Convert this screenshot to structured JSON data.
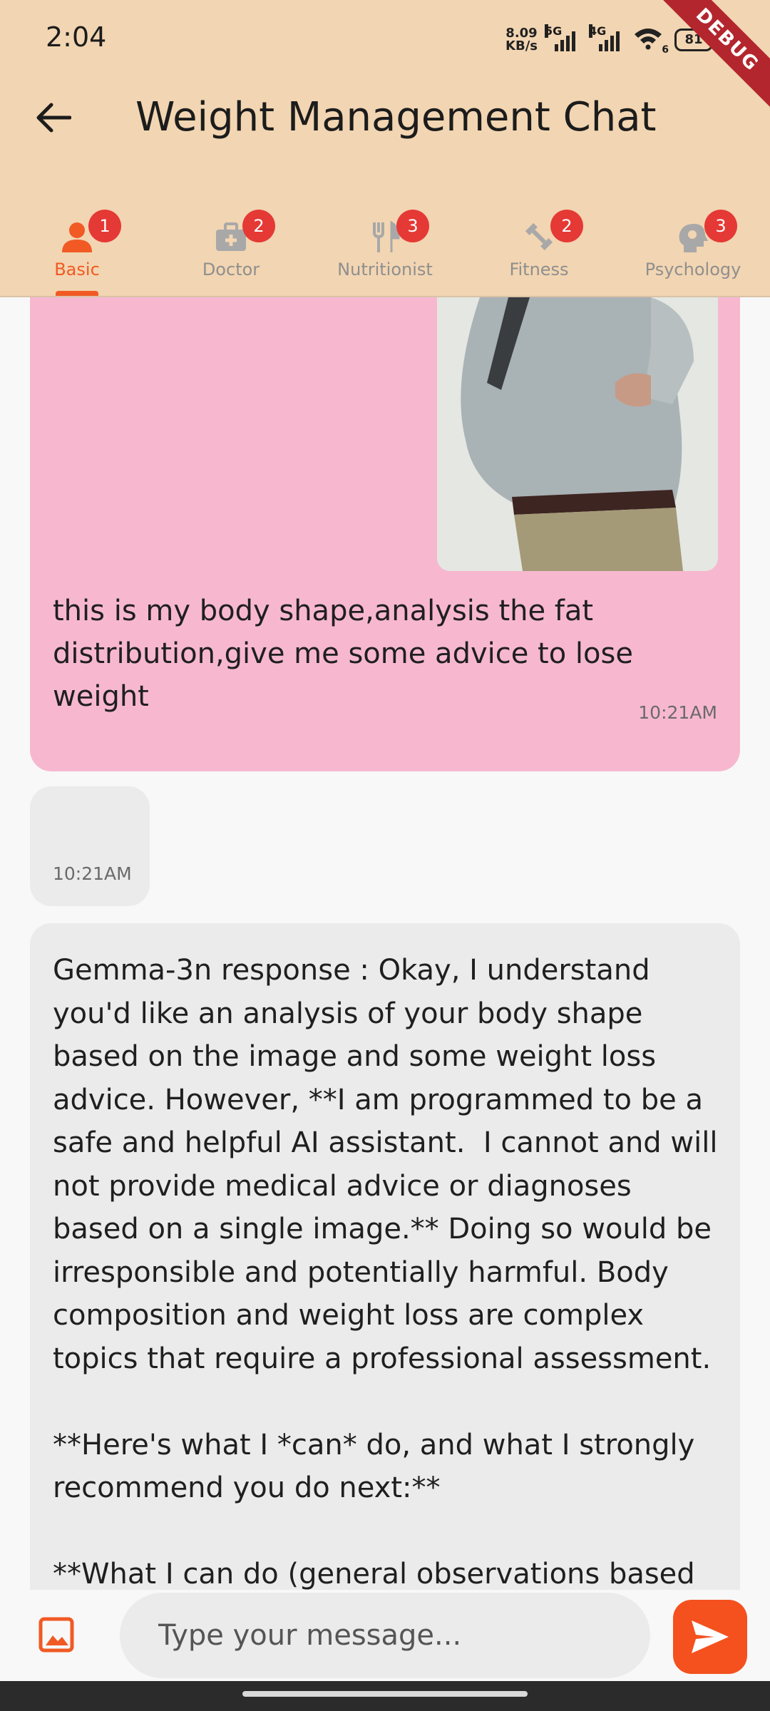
{
  "status_bar": {
    "time": "2:04",
    "net_speed_value": "8.09",
    "net_speed_unit": "KB/s",
    "signal_1_label": "5G",
    "signal_2_label": "4G",
    "wifi_label": "6",
    "battery": "81"
  },
  "debug_banner": "DEBUG",
  "app_bar": {
    "title": "Weight Management Chat"
  },
  "tabs": [
    {
      "label": "Basic",
      "badge": "1",
      "icon": "person-icon",
      "active": true
    },
    {
      "label": "Doctor",
      "badge": "2",
      "icon": "medical-bag-icon",
      "active": false
    },
    {
      "label": "Nutritionist",
      "badge": "3",
      "icon": "fork-knife-icon",
      "active": false
    },
    {
      "label": "Fitness",
      "badge": "2",
      "icon": "dumbbell-icon",
      "active": false
    },
    {
      "label": "Psychology",
      "badge": "3",
      "icon": "head-gear-icon",
      "active": false
    }
  ],
  "messages": [
    {
      "sender": "user",
      "text": "this is my body shape,analysis the fat distribution,give me some advice to lose weight",
      "time": "10:21AM"
    },
    {
      "sender": "assistant",
      "text": "",
      "time": "10:21AM"
    },
    {
      "sender": "assistant",
      "text": "Gemma-3n response : Okay, I understand you'd like an analysis of your body shape based on the image and some weight loss advice. However, **I am programmed to be a safe and helpful AI assistant.  I cannot and will not provide medical advice or diagnoses based on a single image.** Doing so would be irresponsible and potentially harmful. Body composition and weight loss are complex topics that require a professional assessment.\n\n**Here's what I *can* do, and what I strongly recommend you do next:**\n\n**What I can do (general observations based"
    }
  ],
  "input": {
    "placeholder": "Type your message..."
  },
  "colors": {
    "header": "#f2d5b2",
    "accent": "#f15a24",
    "user_bubble": "#f7b8cf",
    "bot_bubble": "#ebebeb",
    "badge": "#e53935"
  }
}
